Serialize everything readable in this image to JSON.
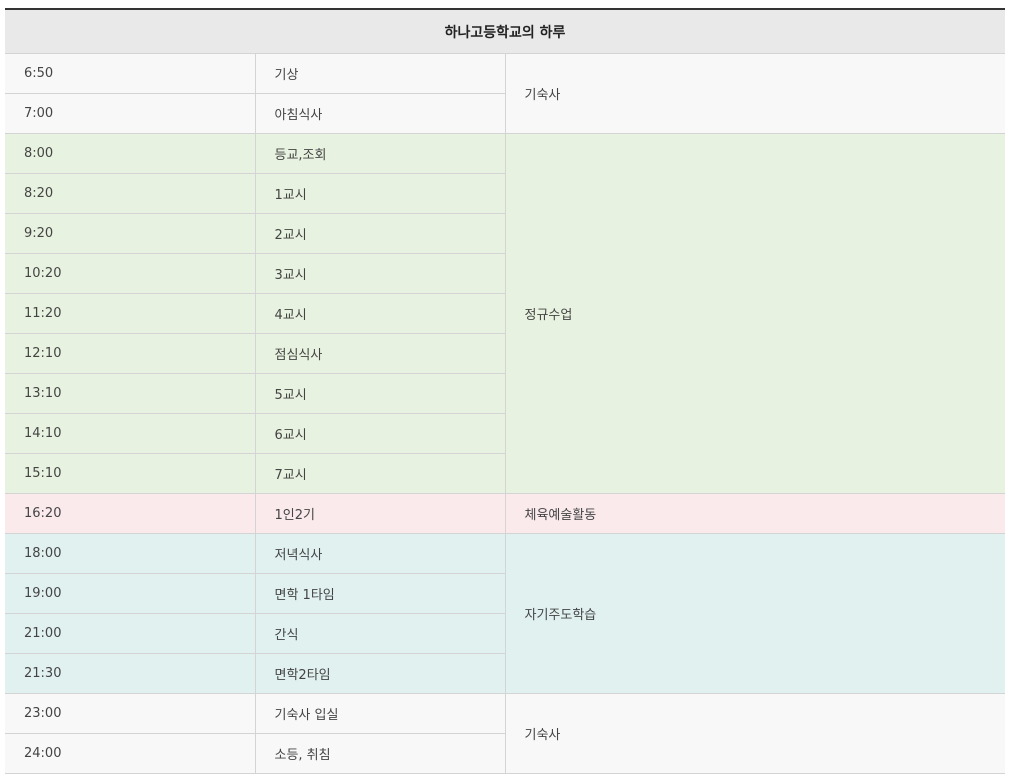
{
  "title": "하나고등학교의 하루",
  "groups": [
    {
      "label": "기숙사",
      "color": "#f8f8f8"
    },
    {
      "label": "정규수업",
      "color": "#e8f2e0"
    },
    {
      "label": "체육예술활동",
      "color": "#faeaec"
    },
    {
      "label": "자기주도학습",
      "color": "#e1f1f0"
    },
    {
      "label": "기숙사",
      "color": "#f8f8f8"
    }
  ],
  "rows": [
    {
      "time": "6:50",
      "activity": "기상"
    },
    {
      "time": "7:00",
      "activity": "아침식사"
    },
    {
      "time": "8:00",
      "activity": "등교,조회"
    },
    {
      "time": "8:20",
      "activity": "1교시"
    },
    {
      "time": "9:20",
      "activity": "2교시"
    },
    {
      "time": "10:20",
      "activity": "3교시"
    },
    {
      "time": "11:20",
      "activity": "4교시"
    },
    {
      "time": "12:10",
      "activity": "점심식사"
    },
    {
      "time": "13:10",
      "activity": "5교시"
    },
    {
      "time": "14:10",
      "activity": "6교시"
    },
    {
      "time": "15:10",
      "activity": "7교시"
    },
    {
      "time": "16:20",
      "activity": "1인2기"
    },
    {
      "time": "18:00",
      "activity": "저녁식사"
    },
    {
      "time": "19:00",
      "activity": "면학 1타임"
    },
    {
      "time": "21:00",
      "activity": "간식"
    },
    {
      "time": "21:30",
      "activity": "면학2타임"
    },
    {
      "time": "23:00",
      "activity": "기숙사 입실"
    },
    {
      "time": "24:00",
      "activity": "소등, 취침"
    }
  ]
}
